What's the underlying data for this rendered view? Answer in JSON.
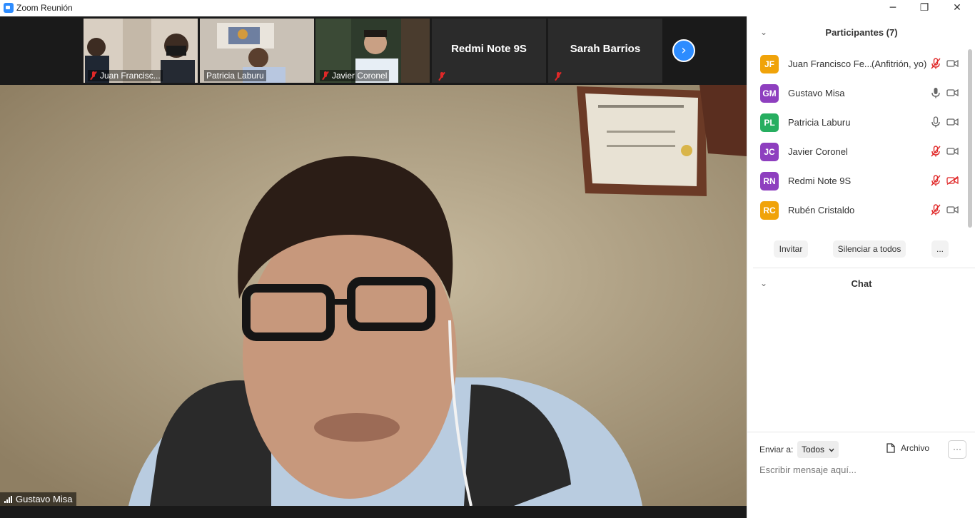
{
  "window": {
    "title": "Zoom Reunión",
    "minimize_icon": "minimize-icon",
    "restore_icon": "restore-icon",
    "close_icon": "close-icon",
    "minimize_glyph": "─",
    "restore_glyph": "❐",
    "close_glyph": "✕"
  },
  "video_strip": {
    "thumbnails": [
      {
        "name": "Juan Francisc...",
        "muted": true
      },
      {
        "name": "Patricia Laburu",
        "muted": false
      },
      {
        "name": "Javier Coronel",
        "muted": true
      },
      {
        "name": "Redmi Note 9S",
        "muted": true
      },
      {
        "name": "Sarah Barrios",
        "muted": true
      }
    ],
    "next_glyph": "›"
  },
  "main_video": {
    "speaker_name": "Gustavo Misa"
  },
  "participants_panel": {
    "title": "Participantes (7)",
    "chevron_glyph": "⌄",
    "participants": [
      {
        "initials": "JF",
        "name": "Juan Francisco Fe...",
        "role": "(Anfitrión, yo)",
        "avatar_color": "#f0a30a",
        "mic": "muted",
        "camera": "on"
      },
      {
        "initials": "GM",
        "name": "Gustavo Misa",
        "role": "",
        "avatar_color": "#8e3fbf",
        "mic": "on",
        "camera": "on"
      },
      {
        "initials": "PL",
        "name": "Patricia Laburu",
        "role": "",
        "avatar_color": "#27ae60",
        "mic": "on",
        "camera": "on"
      },
      {
        "initials": "JC",
        "name": "Javier Coronel",
        "role": "",
        "avatar_color": "#8e3fbf",
        "mic": "muted",
        "camera": "on"
      },
      {
        "initials": "RN",
        "name": "Redmi Note 9S",
        "role": "",
        "avatar_color": "#8e3fbf",
        "mic": "muted",
        "camera": "off"
      },
      {
        "initials": "RC",
        "name": "Rubén Cristaldo",
        "role": "",
        "avatar_color": "#f0a30a",
        "mic": "muted",
        "camera": "on"
      }
    ],
    "invite_label": "Invitar",
    "mute_all_label": "Silenciar a todos",
    "more_label": "..."
  },
  "chat_panel": {
    "title": "Chat",
    "send_to_label": "Enviar a:",
    "send_to_value": "Todos",
    "file_label": "Archivo",
    "more_label": "···",
    "input_placeholder": "Escribir mensaje aquí..."
  },
  "colors": {
    "accent": "#2d8cff",
    "muted_red": "#e02828"
  }
}
